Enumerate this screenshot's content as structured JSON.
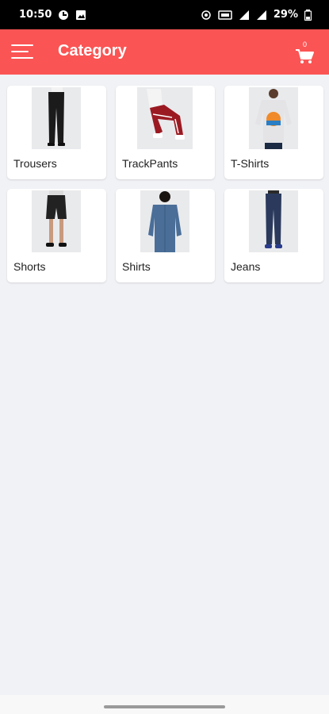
{
  "status_bar": {
    "time": "10:50",
    "battery": "29%"
  },
  "app_bar": {
    "title": "Category",
    "cart_count": "0"
  },
  "colors": {
    "accent": "#fb5454",
    "background": "#f1f2f6"
  },
  "categories": [
    {
      "label": "Trousers",
      "icon": "trousers-photo"
    },
    {
      "label": "TrackPants",
      "icon": "trackpants-photo"
    },
    {
      "label": "T-Shirts",
      "icon": "tshirt-photo"
    },
    {
      "label": "Shorts",
      "icon": "shorts-photo"
    },
    {
      "label": "Shirts",
      "icon": "shirt-photo"
    },
    {
      "label": "Jeans",
      "icon": "jeans-photo"
    }
  ]
}
